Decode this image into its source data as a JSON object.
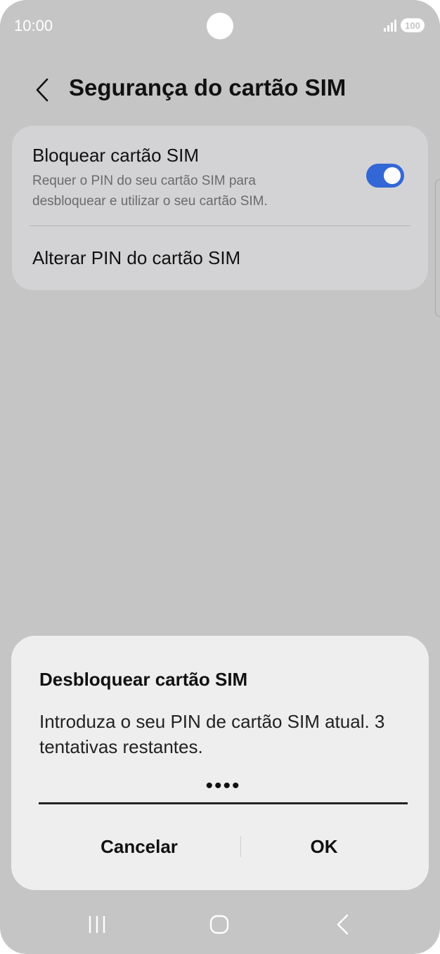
{
  "status_bar": {
    "time": "10:00",
    "battery": "100"
  },
  "header": {
    "title": "Segurança do cartão SIM",
    "back_icon": "chevron-left-icon"
  },
  "settings": {
    "lock_sim": {
      "title": "Bloquear cartão SIM",
      "subtitle": "Requer o PIN do seu cartão SIM para desbloquear e utilizar o seu cartão SIM.",
      "enabled": true
    },
    "change_pin": {
      "label": "Alterar PIN do cartão SIM"
    }
  },
  "dialog": {
    "title": "Desbloquear cartão SIM",
    "message": "Introduza o seu PIN de cartão SIM atual. 3 tentativas restantes.",
    "pin_value": "••••",
    "cancel_label": "Cancelar",
    "ok_label": "OK"
  },
  "nav_bar": {
    "recents_icon": "recents-icon",
    "home_icon": "home-icon",
    "back_icon": "back-icon"
  },
  "colors": {
    "background": "#c5c5c5",
    "card": "#d3d3d5",
    "dialog": "#eeeeee",
    "accent": "#3367d6"
  }
}
